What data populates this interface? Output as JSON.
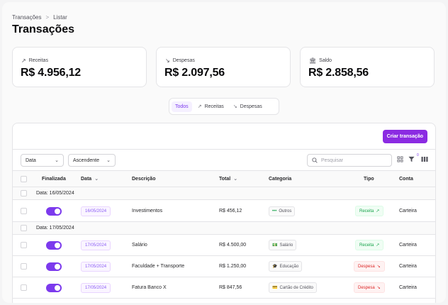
{
  "breadcrumb": {
    "root": "Transações",
    "separator": ">",
    "current": "Listar"
  },
  "title": "Transações",
  "summary": [
    {
      "label": "Receitas",
      "icon": "trending-up-icon",
      "glyph": "↗",
      "value": "R$ 4.956,12"
    },
    {
      "label": "Despesas",
      "icon": "trending-down-icon",
      "glyph": "↘",
      "value": "R$ 2.097,56"
    },
    {
      "label": "Saldo",
      "icon": "bank-icon",
      "glyph": "🏛",
      "value": "R$ 2.858,56"
    }
  ],
  "filter_tabs": [
    {
      "label": "Todos",
      "active": true,
      "glyph": ""
    },
    {
      "label": "Receitas",
      "active": false,
      "glyph": "↗"
    },
    {
      "label": "Despesas",
      "active": false,
      "glyph": "↘"
    }
  ],
  "toolbar": {
    "create_label": "Criar transação",
    "sort_field": "Data",
    "sort_order": "Ascendente",
    "search_placeholder": "Pesquisar",
    "filter_count": "0"
  },
  "columns": {
    "finalizada": "Finalizada",
    "data": "Data",
    "descricao": "Descrição",
    "total": "Total",
    "categoria": "Categoria",
    "tipo": "Tipo",
    "conta": "Conta"
  },
  "groups": [
    {
      "label": "Data: 16/05/2024",
      "rows": [
        {
          "date": "16/05/2024",
          "description": "Investimentos",
          "total": "R$ 456,12",
          "category": "Outros",
          "category_glyph": "•••",
          "type": "Receita",
          "type_kind": "rec",
          "type_glyph": "↗",
          "account": "Carteira"
        }
      ]
    },
    {
      "label": "Data: 17/05/2024",
      "rows": [
        {
          "date": "17/05/2024",
          "description": "Salário",
          "total": "R$ 4.500,00",
          "category": "Salário",
          "category_glyph": "💵",
          "type": "Receita",
          "type_kind": "rec",
          "type_glyph": "↗",
          "account": "Carteira"
        },
        {
          "date": "17/05/2024",
          "description": "Faculdade + Transporte",
          "total": "R$ 1.250,00",
          "category": "Educação",
          "category_glyph": "🎓",
          "type": "Despesa",
          "type_kind": "desp",
          "type_glyph": "↘",
          "account": "Carteira"
        },
        {
          "date": "17/05/2024",
          "description": "Fatura Banco X",
          "total": "R$ 847,56",
          "category": "Cartão de Crédito",
          "category_glyph": "💳",
          "type": "Despesa",
          "type_kind": "desp",
          "type_glyph": "↘",
          "account": "Carteira"
        }
      ]
    }
  ]
}
